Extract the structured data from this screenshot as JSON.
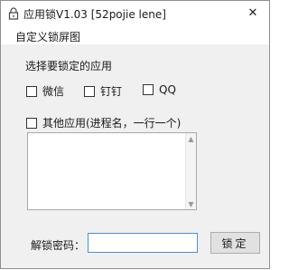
{
  "window": {
    "title": "应用锁V1.03 [52pojie lene]",
    "close_symbol": "✕"
  },
  "menu": {
    "items": [
      "自定义锁屏图"
    ]
  },
  "select_section": {
    "label": "选择要锁定的应用"
  },
  "apps": [
    {
      "label": "微信",
      "checked": false
    },
    {
      "label": "钉钉",
      "checked": false
    },
    {
      "label": "QQ",
      "checked": false
    }
  ],
  "other_apps": {
    "label": "其他应用(进程名，一行一个)",
    "checked": false
  },
  "other_apps_list": {
    "value": ""
  },
  "password": {
    "label": "解锁密码：",
    "value": ""
  },
  "lock_button": {
    "label": "锁定"
  },
  "colors": {
    "input_border_focus": "#4a90d9",
    "window_bg": "#f0f0f0",
    "title_bg": "#ffffff"
  }
}
